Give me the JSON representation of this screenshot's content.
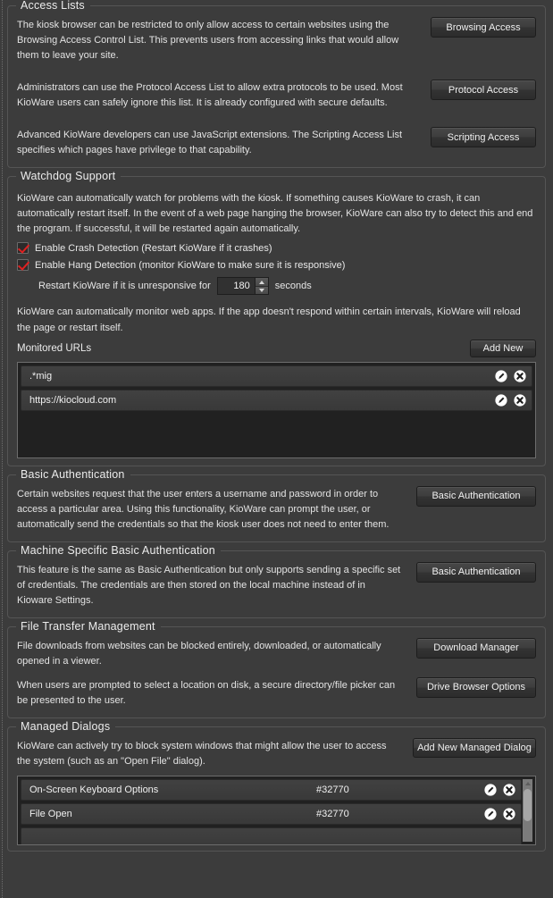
{
  "theme": {
    "background": "#3c3c3c",
    "group_border": "#555555",
    "text": "#e6e6e6",
    "checkbox_check": "#e02020",
    "list_background": "#212121",
    "list_row": "#3d3d3d"
  },
  "sections": {
    "access_lists": {
      "title": "Access Lists",
      "rows": [
        {
          "text": "The kiosk browser can be restricted to only allow access to certain websites using the Browsing Access Control List. This prevents users from accessing links that would allow them to leave your site.",
          "button": "Browsing Access"
        },
        {
          "text": "Administrators can use the Protocol Access List to allow extra protocols to be used. Most KioWare users can safely ignore this list. It is already configured with secure defaults.",
          "button": "Protocol Access"
        },
        {
          "text": "Advanced KioWare developers can use JavaScript extensions. The Scripting Access List specifies which pages have privilege to that capability.",
          "button": "Scripting Access"
        }
      ]
    },
    "watchdog": {
      "title": "Watchdog Support",
      "intro": "KioWare can automatically watch for problems with the kiosk. If something causes KioWare to crash, it can automatically restart itself. In the event of a web page hanging the browser, KioWare can also try to detect this and end the program. If successful, it will be restarted again automatically.",
      "crash_detection": {
        "label": "Enable Crash Detection (Restart KioWare if it crashes)",
        "checked": true
      },
      "hang_detection": {
        "label": "Enable Hang Detection (monitor KioWare to make sure it is responsive)",
        "checked": true
      },
      "unresponsive": {
        "label_before": "Restart KioWare if it is unresponsive for",
        "value": "180",
        "label_after": "seconds"
      },
      "monitor_note": "KioWare can automatically monitor web apps. If the app doesn't respond within certain intervals, KioWare will reload the page or restart itself.",
      "monitored_urls": {
        "label": "Monitored URLs",
        "add_button": "Add New",
        "items": [
          {
            "url": ".*mig"
          },
          {
            "url": "https://kiocloud.com"
          }
        ]
      }
    },
    "basic_auth": {
      "title": "Basic Authentication",
      "text": "Certain websites request that the user enters a username and password in order to access a particular area. Using this functionality, KioWare can prompt the user, or automatically send the credentials so that the kiosk user does not need to enter them.",
      "button": "Basic Authentication"
    },
    "machine_basic_auth": {
      "title": "Machine Specific Basic Authentication",
      "text": "This feature is the same as Basic Authentication but only supports sending a specific set of credentials. The credentials are then stored on the local machine instead of in Kioware Settings.",
      "button": "Basic Authentication"
    },
    "file_transfer": {
      "title": "File Transfer Management",
      "rows": [
        {
          "text": "File downloads from websites can be blocked entirely, downloaded, or automatically opened in a viewer.",
          "button": "Download Manager"
        },
        {
          "text": "When users are prompted to select a location on disk, a secure directory/file picker can be presented to the user.",
          "button": "Drive Browser Options"
        }
      ]
    },
    "managed_dialogs": {
      "title": "Managed Dialogs",
      "text": "KioWare can actively try to block system windows that might allow the user to access the system (such as an \"Open File\" dialog).",
      "add_button": "Add New Managed Dialog",
      "items": [
        {
          "name": "On-Screen Keyboard Options",
          "id": "#32770"
        },
        {
          "name": "File Open",
          "id": "#32770"
        }
      ]
    }
  },
  "icons": {
    "edit": "edit-icon",
    "delete": "delete-icon"
  }
}
